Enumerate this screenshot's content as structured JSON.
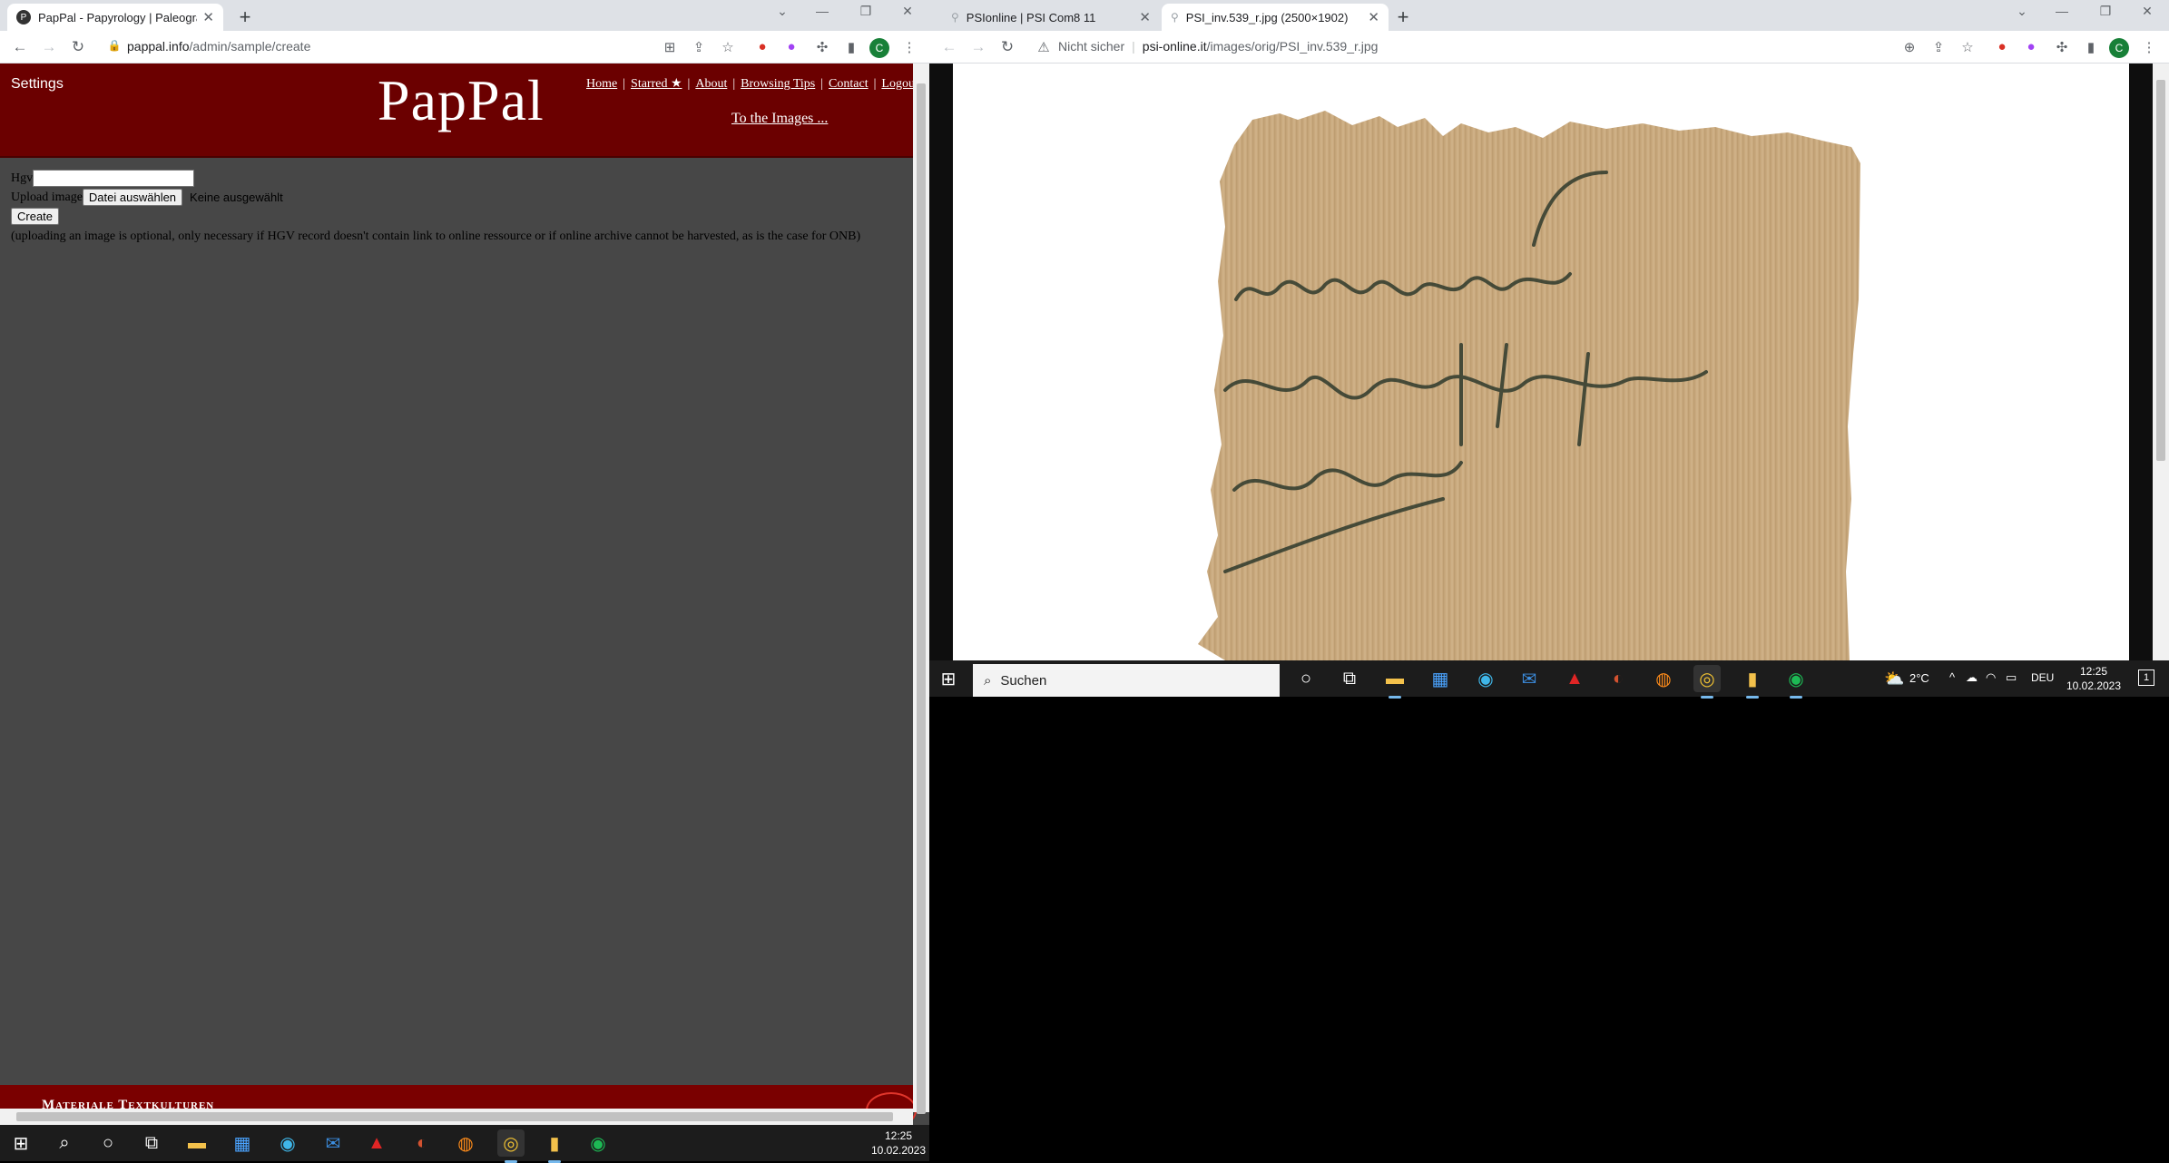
{
  "left_browser": {
    "tab": {
      "title": "PapPal - Papyrology | Paleography",
      "favicon": "P"
    },
    "address": {
      "host": "pappal.info",
      "path": "/admin/sample/create"
    },
    "avatar_letter": "C"
  },
  "pappal": {
    "settings_label": "Settings",
    "logo": "PapPal",
    "nav": [
      "Home",
      "Starred ★",
      "About",
      "Browsing Tips",
      "Contact",
      "Logout"
    ],
    "to_images": "To the Images ...",
    "form": {
      "hgv_label": "Hgv",
      "hgv_value": "",
      "upload_label": "Upload image",
      "choose_file_button": "Datei auswählen",
      "no_file_text": "Keine ausgewählt",
      "create_button": "Create",
      "note": "(uploading an image is optional, only necessary if HGV record doesn't contain link to online ressource or if online archive cannot be harvested, as is the case for ONB)"
    },
    "footer": "Materiale Textkulturen"
  },
  "right_browser": {
    "tabs": [
      {
        "title": "PSIonline | PSI Com8 11"
      },
      {
        "title": "PSI_inv.539_r.jpg (2500×1902)"
      }
    ],
    "address": {
      "security": "Nicht sicher",
      "host": "psi-online.it",
      "path": "/images/orig/PSI_inv.539_r.jpg"
    },
    "avatar_letter": "C"
  },
  "taskbar_right": {
    "search_placeholder": "Suchen",
    "weather": "2°C",
    "language": "DEU",
    "time": "12:25",
    "date": "10.02.2023",
    "notification_count": "1"
  },
  "taskbar_left": {
    "time": "12:25",
    "date": "10.02.2023"
  },
  "colors": {
    "pappal_header": "#6b0000",
    "page_bg": "#474747",
    "footer": "#7a0000",
    "papyrus": "#c9a97e",
    "ink": "#2f3a2c"
  }
}
